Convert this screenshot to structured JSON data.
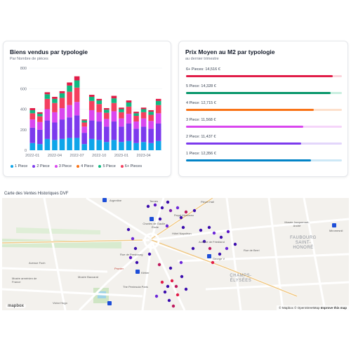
{
  "left_card": {
    "title": "Biens vendus par typologie",
    "subtitle": "Par Nombre de pièces"
  },
  "right_card": {
    "title": "Prix Moyen au M2 par typologie",
    "subtitle": "au dernier trimestre"
  },
  "chart_data": {
    "type": "bar",
    "stacked": true,
    "title": "Biens vendus par typologie",
    "subtitle": "Par Nombre de pièces",
    "y_ticks": [
      "0",
      "200",
      "400",
      "600",
      "800"
    ],
    "ylim": [
      0,
      800
    ],
    "x_tick_labels": [
      "2022-01",
      "2022-04",
      "2022-07",
      "2022-10",
      "2023-01",
      "2023-04"
    ],
    "categories": [
      "2022-01",
      "2022-02",
      "2022-03",
      "2022-04",
      "2022-05",
      "2022-06",
      "2022-07",
      "2022-08",
      "2022-09",
      "2022-10",
      "2022-11",
      "2022-12",
      "2023-01",
      "2023-02",
      "2023-03",
      "2023-04",
      "2023-05",
      "2023-06"
    ],
    "series": [
      {
        "name": "1 Piece",
        "color": "#0ea5e9",
        "values": [
          70,
          60,
          110,
          100,
          110,
          120,
          120,
          60,
          110,
          100,
          80,
          100,
          80,
          90,
          70,
          80,
          70,
          90
        ]
      },
      {
        "name": "2 Piece",
        "color": "#7c3aed",
        "values": [
          150,
          140,
          180,
          170,
          190,
          200,
          220,
          110,
          180,
          180,
          150,
          180,
          150,
          170,
          140,
          150,
          140,
          170
        ]
      },
      {
        "name": "3 Piece",
        "color": "#d946ef",
        "values": [
          80,
          75,
          110,
          100,
          110,
          120,
          130,
          60,
          100,
          90,
          75,
          100,
          80,
          95,
          70,
          80,
          75,
          100
        ]
      },
      {
        "name": "4 Piece",
        "color": "#f43f5e",
        "values": [
          60,
          55,
          100,
          90,
          100,
          130,
          140,
          40,
          90,
          80,
          60,
          80,
          60,
          70,
          55,
          60,
          60,
          80
        ]
      },
      {
        "name": "5 Piece",
        "color": "#10b981",
        "values": [
          30,
          25,
          45,
          40,
          45,
          60,
          70,
          20,
          40,
          35,
          30,
          45,
          30,
          40,
          25,
          30,
          30,
          40
        ]
      },
      {
        "name": "6+ Pieces",
        "color": "#e11d48",
        "values": [
          20,
          15,
          20,
          20,
          20,
          30,
          40,
          10,
          20,
          15,
          15,
          25,
          15,
          20,
          15,
          15,
          15,
          20
        ]
      }
    ],
    "grid": true
  },
  "legend": [
    {
      "label": "1 Piece",
      "color": "#0ea5e9"
    },
    {
      "label": "2 Piece",
      "color": "#7c3aed"
    },
    {
      "label": "3 Piece",
      "color": "#d946ef"
    },
    {
      "label": "4 Piece",
      "color": "#f97316"
    },
    {
      "label": "5 Piece",
      "color": "#10b981"
    },
    {
      "label": "6+ Pieces",
      "color": "#f43f5e"
    }
  ],
  "prices": [
    {
      "label": "6+ Pieces: 14,516 €",
      "color": "#e11d48",
      "track": "#fbd5dc",
      "fill": 0.94
    },
    {
      "label": "5 Piece: 14,328 €",
      "color": "#059669",
      "track": "#c9efe0",
      "fill": 0.93
    },
    {
      "label": "4 Piece: 12,715 €",
      "color": "#f97316",
      "track": "#fde0cc",
      "fill": 0.82
    },
    {
      "label": "3 Piece: 11,568 €",
      "color": "#d946ef",
      "track": "#f5d5fa",
      "fill": 0.75
    },
    {
      "label": "2 Piece: 11,437 €",
      "color": "#7c3aed",
      "track": "#e3d6fb",
      "fill": 0.74
    },
    {
      "label": "1 Piece: 12,356 €",
      "color": "#0284c7",
      "track": "#cde8f6",
      "fill": 0.8
    }
  ],
  "map": {
    "title": "Carte des Ventes Historiques DVF",
    "logo": "mapbox",
    "attribution_mapbox": "© Mapbox",
    "attribution_osm": "© OpenStreetMap",
    "attribution_improve": "Improve this map",
    "labels": {
      "argentine": "Argentine",
      "charles_de_gaulle": "Charles de Gaulle – Étoile",
      "hotel_napoleon": "Hôtel Napoléon",
      "george_v": "George V",
      "kleber": "Kléber",
      "champs": "CHAMPS-ÉLYSÉES",
      "faubourg": "FAUBOURG SAINT-HONORÉ",
      "avenue_foch": "Avenue Foch",
      "avenue_friedland": "Avenue de Friedland",
      "rue_berri": "Rue de Berri",
      "pleyel": "Pleyel Hall",
      "musee_armenien": "Musée arménien de France",
      "musee_baccarat": "Musée Baccarat",
      "peninsula": "The Peninsula Paris",
      "victor_hugo": "Victor Hugo",
      "miromesnil": "Miromesnil",
      "musee_jacquemart": "Musée Jacquemart-André",
      "royal_monceau": "Royal Monceau",
      "prunier": "Prunier",
      "ternes": "Ternes",
      "rue_presbourg": "Rue de Presbourg"
    }
  }
}
